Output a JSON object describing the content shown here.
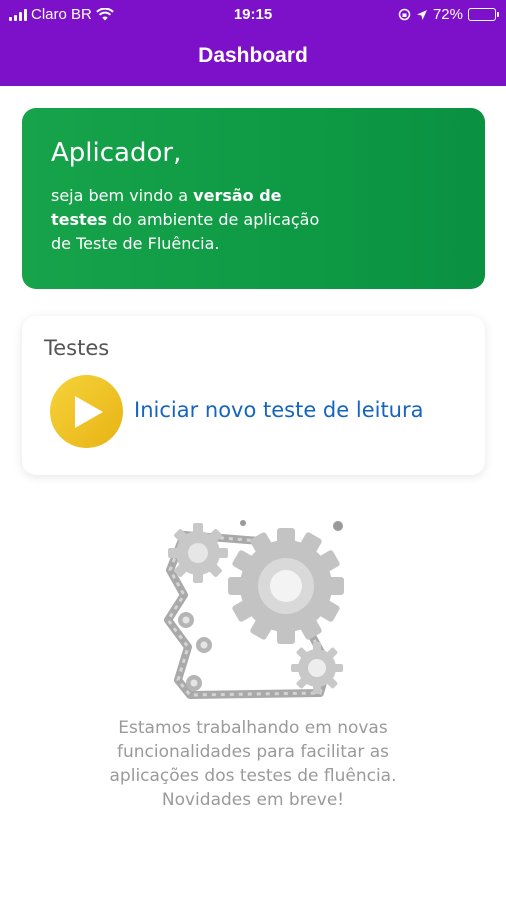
{
  "status_bar": {
    "carrier": "Claro BR",
    "time": "19:15",
    "battery": "72%",
    "icons": [
      "signal-bars-icon",
      "wifi-icon",
      "orientation-lock-icon",
      "location-arrow-icon",
      "battery-icon"
    ]
  },
  "header": {
    "title": "Dashboard",
    "color": "#7d10c9"
  },
  "welcome_card": {
    "greeting": "Aplicador,",
    "message_part1": "seja bem vindo a ",
    "message_bold": "versão de testes",
    "message_part2": " do ambiente de aplicação de Teste de Fluência.",
    "color": "#0e9a45"
  },
  "tests_card": {
    "label": "Testes",
    "action_label": "Iniciar novo teste de leitura",
    "action_icon": "play-icon",
    "link_color": "#1565c0"
  },
  "placeholder": {
    "illustration": "gears-illustration",
    "lines": [
      "Estamos trabalhando em novas",
      "funcionalidades para facilitar as",
      "aplicações dos testes de fluência.",
      "Novidades em breve!"
    ]
  }
}
